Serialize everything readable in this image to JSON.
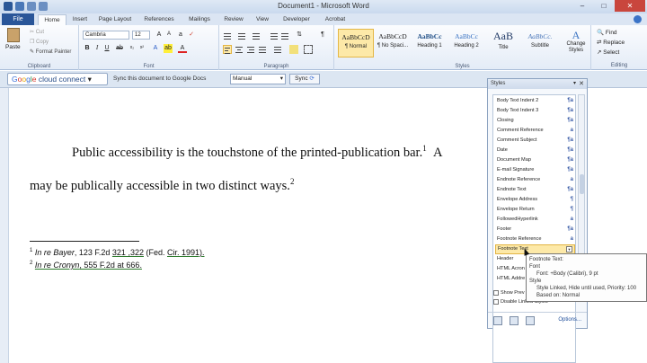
{
  "window": {
    "title": "Document1 - Microsoft Word"
  },
  "tabs": [
    "File",
    "Home",
    "Insert",
    "Page Layout",
    "References",
    "Mailings",
    "Review",
    "View",
    "Developer",
    "Acrobat"
  ],
  "active_tab": "Home",
  "ribbon": {
    "clipboard": {
      "paste": "Paste",
      "cut": "Cut",
      "copy": "Copy",
      "format_painter": "Format Painter",
      "label": "Clipboard"
    },
    "font": {
      "name": "Cambria",
      "size": "12",
      "label": "Font"
    },
    "paragraph": {
      "label": "Paragraph"
    },
    "styles": {
      "label": "Styles",
      "items": [
        {
          "preview": "AaBbCcD",
          "name": "¶ Normal"
        },
        {
          "preview": "AaBbCcD",
          "name": "¶ No Spaci..."
        },
        {
          "preview": "AaBbCc",
          "name": "Heading 1"
        },
        {
          "preview": "AaBbCc",
          "name": "Heading 2"
        },
        {
          "preview": "AaB",
          "name": "Title"
        },
        {
          "preview": "AaBbCc.",
          "name": "Subtitle"
        }
      ],
      "change_styles": "Change Styles"
    },
    "editing": {
      "find": "Find",
      "replace": "Replace",
      "select": "Select",
      "label": "Editing"
    }
  },
  "gcc": {
    "brand_google": [
      "G",
      "o",
      "o",
      "g",
      "l",
      "e"
    ],
    "brand_rest": " cloud connect",
    "message": "Sync this document to Google Docs",
    "mode": "Manual",
    "sync": "Sync"
  },
  "document": {
    "line1_text": "Public accessibility is the touchstone of the printed-publication bar.",
    "line1_sup": "1",
    "line1_tail": "A",
    "line2_text": "may be publically accessible in two distinct ways.",
    "line2_sup": "2",
    "footnote1": {
      "num": "1",
      "case": "In re Bayer",
      "cite_a": ", 123 F.2d ",
      "cite_b": "321 ,322",
      "cite_c": " (Fed. ",
      "cite_d": "Cir.",
      "cite_e": " 1991)."
    },
    "footnote2": {
      "num": "2",
      "case": "In re Cronyn",
      "cite": ", 555 F.2d at 666."
    }
  },
  "styles_pane": {
    "title": "Styles",
    "items": [
      {
        "name": "Body Text Indent 2",
        "mark": "¶a"
      },
      {
        "name": "Body Text Indent 3",
        "mark": "¶a"
      },
      {
        "name": "Closing",
        "mark": "¶a"
      },
      {
        "name": "Comment Reference",
        "mark": "a"
      },
      {
        "name": "Comment Subject",
        "mark": "¶a"
      },
      {
        "name": "Date",
        "mark": "¶a"
      },
      {
        "name": "Document Map",
        "mark": "¶a"
      },
      {
        "name": "E-mail Signature",
        "mark": "¶a"
      },
      {
        "name": "Endnote Reference",
        "mark": "a"
      },
      {
        "name": "Endnote Text",
        "mark": "¶a"
      },
      {
        "name": "Envelope Address",
        "mark": "¶"
      },
      {
        "name": "Envelope Return",
        "mark": "¶"
      },
      {
        "name": "FollowedHyperlink",
        "mark": "a"
      },
      {
        "name": "Footer",
        "mark": "¶a"
      },
      {
        "name": "Footnote Reference",
        "mark": "a"
      },
      {
        "name": "Footnote Text",
        "mark": "▼"
      },
      {
        "name": "Header",
        "mark": ""
      },
      {
        "name": "HTML Acron",
        "mark": ""
      },
      {
        "name": "HTML Addre",
        "mark": ""
      }
    ],
    "show_preview": "Show Prev",
    "disable_linked": "Disable Linked Styles",
    "options": "Options..."
  },
  "tooltip": {
    "line1": "Footnote Text:",
    "line2": "Font",
    "line3": "Font: +Body (Calibri), 9 pt",
    "line4": "Style",
    "line5": "Style Linked, Hide until used, Priority: 100",
    "line6": "Based on: Normal"
  },
  "colors": {
    "file_tab": "#2a5699",
    "highlight": "#fde9a8",
    "close_button": "#c9463d"
  }
}
